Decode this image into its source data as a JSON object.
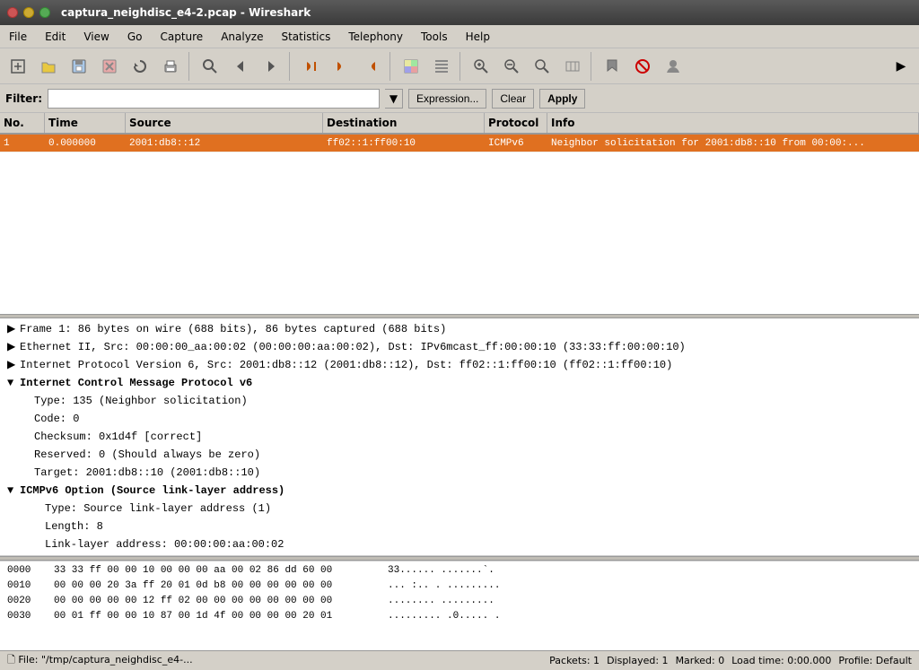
{
  "titlebar": {
    "title": "captura_neighdisc_e4-2.pcap - Wireshark"
  },
  "menubar": {
    "items": [
      "File",
      "Edit",
      "View",
      "Go",
      "Capture",
      "Analyze",
      "Statistics",
      "Telephony",
      "Tools",
      "Help"
    ]
  },
  "toolbar": {
    "buttons": [
      {
        "name": "new-capture",
        "icon": "🗋"
      },
      {
        "name": "open-file",
        "icon": "📂"
      },
      {
        "name": "save-file",
        "icon": "💾"
      },
      {
        "name": "close-file",
        "icon": "✕"
      },
      {
        "name": "reload",
        "icon": "↺"
      },
      {
        "name": "print",
        "icon": "🖨"
      },
      {
        "name": "find",
        "icon": "🔍"
      },
      {
        "name": "back",
        "icon": "◀"
      },
      {
        "name": "forward",
        "icon": "▶"
      },
      {
        "name": "go-first",
        "icon": "⏮"
      },
      {
        "name": "go-prev",
        "icon": "⬆"
      },
      {
        "name": "go-next",
        "icon": "⬇"
      },
      {
        "name": "colorize",
        "icon": "▥"
      },
      {
        "name": "auto-scroll",
        "icon": "▤"
      },
      {
        "name": "zoom-in",
        "icon": "🔍+"
      },
      {
        "name": "zoom-out",
        "icon": "🔍-"
      },
      {
        "name": "normal-size",
        "icon": "⊡"
      },
      {
        "name": "resize-cols",
        "icon": "⇔"
      },
      {
        "name": "mark-packet",
        "icon": "📌"
      },
      {
        "name": "ignore-packet",
        "icon": "🚫"
      },
      {
        "name": "profile",
        "icon": "👤"
      }
    ]
  },
  "filterbar": {
    "label": "Filter:",
    "input_value": "",
    "input_placeholder": "",
    "expression_btn": "Expression...",
    "clear_btn": "Clear",
    "apply_btn": "Apply"
  },
  "packet_list": {
    "headers": [
      "No.",
      "Time",
      "Source",
      "Destination",
      "Protocol",
      "Info"
    ],
    "rows": [
      {
        "no": "1",
        "time": "0.000000",
        "src": "2001:db8::12",
        "dst": "ff02::1:ff00:10",
        "proto": "ICMPv6",
        "info": "Neighbor solicitation for 2001:db8::10 from 00:00:...",
        "selected": true
      }
    ]
  },
  "packet_detail": {
    "sections": [
      {
        "expanded": false,
        "text": "Frame 1: 86 bytes on wire (688 bits), 86 bytes captured (688 bits)"
      },
      {
        "expanded": false,
        "text": "Ethernet II, Src: 00:00:00_aa:00:02 (00:00:00:aa:00:02), Dst: IPv6mcast_ff:00:00:10 (33:33:ff:00:00:10)"
      },
      {
        "expanded": false,
        "text": "Internet Protocol Version 6, Src: 2001:db8::12 (2001:db8::12), Dst: ff02::1:ff00:10 (ff02::1:ff00:10)"
      },
      {
        "expanded": true,
        "text": "Internet Control Message Protocol v6",
        "children": [
          "Type: 135 (Neighbor solicitation)",
          "Code: 0",
          "Checksum: 0x1d4f [correct]",
          "Reserved: 0 (Should always be zero)",
          "Target: 2001:db8::10 (2001:db8::10)"
        ]
      },
      {
        "expanded": true,
        "text": "ICMPv6 Option (Source link-layer address)",
        "children": [
          "Type: Source link-layer address (1)",
          "Length: 8",
          "Link-layer address: 00:00:00:aa:00:02"
        ],
        "indent": true
      }
    ]
  },
  "hex_dump": {
    "rows": [
      {
        "offset": "0000",
        "bytes": "33 33 ff 00 00 10 00 00  00 aa 00 02 86 dd 60 00",
        "ascii": "33......  .......`."
      },
      {
        "offset": "0010",
        "bytes": "00 00 00 20 3a ff 20 01  0d b8 00 00 00 00 00 00",
        "ascii": "... :.. .  ........."
      },
      {
        "offset": "0020",
        "bytes": "00 00 00 00 00 12 ff 02  00 00 00 00 00 00 00 00",
        "ascii": "........  ........."
      },
      {
        "offset": "0030",
        "bytes": "00 01 ff 00 00 10 87 00  1d 4f 00 00 00 00 20 01",
        "ascii": "......... .0..... ."
      }
    ]
  },
  "statusbar": {
    "file": "File: \"/tmp/captura_neighdisc_e4-...",
    "packets": "Packets: 1",
    "displayed": "Displayed: 1",
    "marked": "Marked: 0",
    "load_time": "Load time: 0:00.000",
    "profile": "Profile: Default"
  }
}
